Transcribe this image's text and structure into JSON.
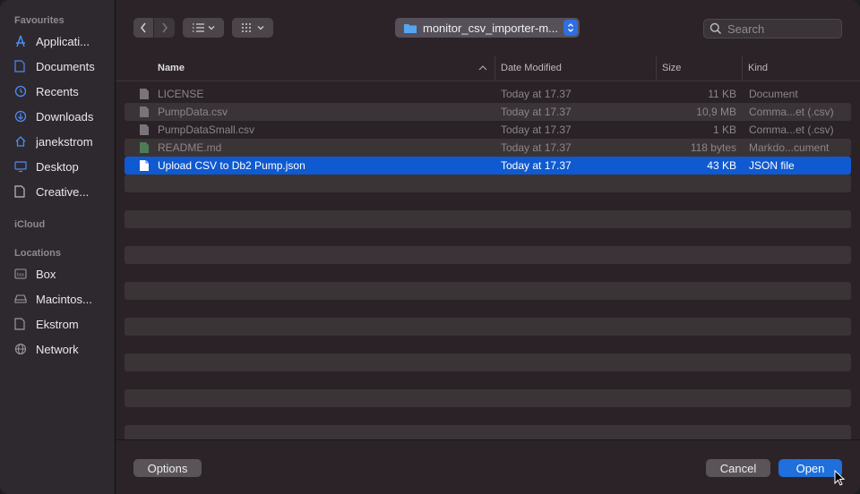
{
  "sidebar": {
    "favourites_label": "Favourites",
    "icloud_label": "iCloud",
    "locations_label": "Locations",
    "favourites": [
      {
        "label": "Applicati...",
        "icon": "applications-icon"
      },
      {
        "label": "Documents",
        "icon": "document-icon"
      },
      {
        "label": "Recents",
        "icon": "clock-icon"
      },
      {
        "label": "Downloads",
        "icon": "downloads-icon"
      },
      {
        "label": "janekstrom",
        "icon": "home-icon"
      },
      {
        "label": "Desktop",
        "icon": "desktop-icon"
      },
      {
        "label": "Creative...",
        "icon": "document-icon"
      }
    ],
    "locations": [
      {
        "label": "Box",
        "icon": "drive-icon"
      },
      {
        "label": "Macintos...",
        "icon": "disk-icon"
      },
      {
        "label": "Ekstrom",
        "icon": "document-icon"
      },
      {
        "label": "Network",
        "icon": "globe-icon"
      }
    ]
  },
  "toolbar": {
    "path_label": "monitor_csv_importer-m...",
    "search_placeholder": "Search"
  },
  "columns": {
    "name": "Name",
    "date": "Date Modified",
    "size": "Size",
    "kind": "Kind"
  },
  "files": [
    {
      "name": "LICENSE",
      "date": "Today at 17.37",
      "size": "11 KB",
      "kind": "Document"
    },
    {
      "name": "PumpData.csv",
      "date": "Today at 17.37",
      "size": "10,9 MB",
      "kind": "Comma...et (.csv)"
    },
    {
      "name": "PumpDataSmall.csv",
      "date": "Today at 17.37",
      "size": "1 KB",
      "kind": "Comma...et (.csv)"
    },
    {
      "name": "README.md",
      "date": "Today at 17.37",
      "size": "118 bytes",
      "kind": "Markdo...cument"
    },
    {
      "name": "Upload CSV to Db2 Pump.json",
      "date": "Today at 17.37",
      "size": "43 KB",
      "kind": "JSON file"
    }
  ],
  "footer": {
    "options_label": "Options",
    "cancel_label": "Cancel",
    "open_label": "Open"
  },
  "colors": {
    "accent": "#1f6fdc",
    "selection": "#0f5ad0"
  }
}
